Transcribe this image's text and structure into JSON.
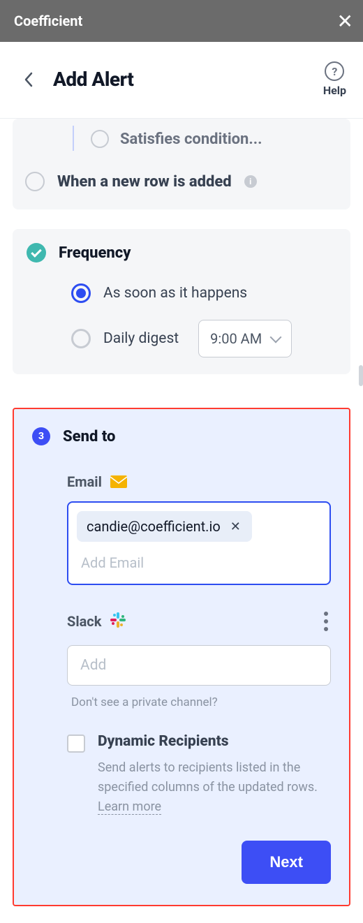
{
  "app": {
    "name": "Coefficient"
  },
  "header": {
    "title": "Add Alert",
    "help_label": "Help"
  },
  "trigger": {
    "satisfies_label": "Satisfies condition...",
    "new_row_label": "When a new row is added"
  },
  "frequency": {
    "title": "Frequency",
    "options": {
      "immediate": "As soon as it happens",
      "daily": "Daily digest"
    },
    "time_value": "9:00 AM"
  },
  "send_to": {
    "step_number": "3",
    "title": "Send to",
    "email": {
      "label": "Email",
      "chips": [
        "candie@coefficient.io"
      ],
      "placeholder": "Add Email"
    },
    "slack": {
      "label": "Slack",
      "placeholder": "Add",
      "private_note": "Don't see a private channel?"
    },
    "dynamic": {
      "title": "Dynamic Recipients",
      "description": "Send alerts to recipients listed in the specified columns of the updated rows. ",
      "learn_more": "Learn more"
    },
    "next_label": "Next"
  }
}
